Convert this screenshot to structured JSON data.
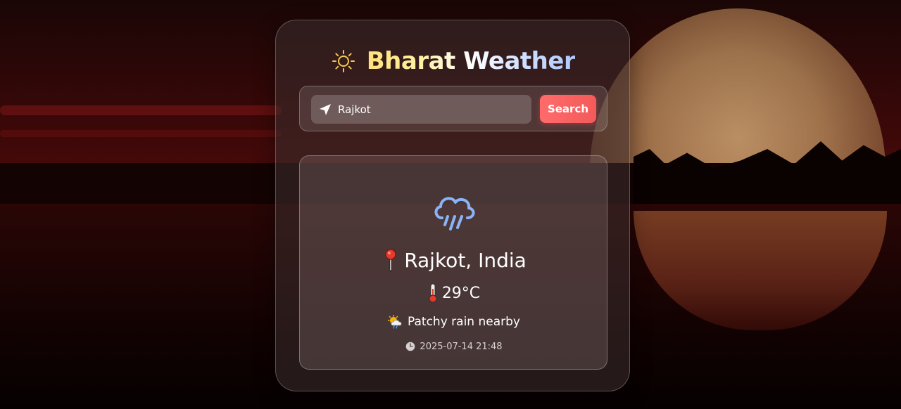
{
  "app": {
    "title": "Bharat Weather"
  },
  "search": {
    "value": "Rajkot",
    "button_label": "Search"
  },
  "weather": {
    "location": "Rajkot, India",
    "temperature": "29°C",
    "condition": "Patchy rain nearby",
    "timestamp": "2025-07-14 21:48",
    "icon": "rain-cloud-icon"
  },
  "colors": {
    "accent": "#f45a5a",
    "title_gradient_start": "#ffe07a",
    "title_gradient_end": "#b0c8ff",
    "rain_icon": "#8ab4f8"
  }
}
